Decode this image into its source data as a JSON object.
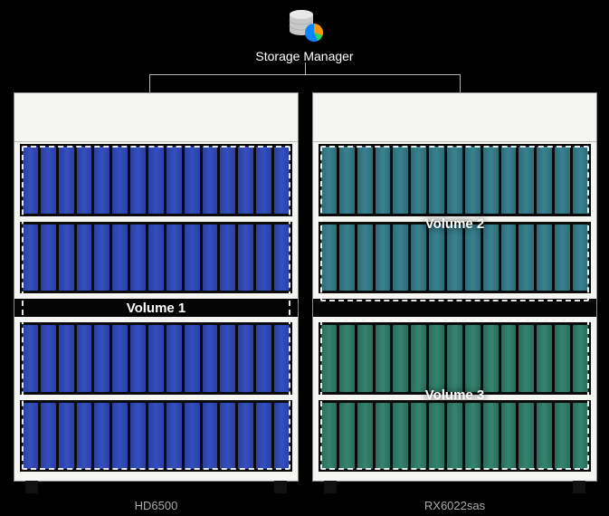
{
  "header": {
    "title": "Storage Manager"
  },
  "units": {
    "left": {
      "model": "HD6500",
      "volumes": [
        {
          "label": "Volume 1",
          "color": "blue"
        }
      ]
    },
    "right": {
      "model": "RX6022sas",
      "volumes": [
        {
          "label": "Volume 2",
          "color": "teal"
        },
        {
          "label": "Volume 3",
          "color": "green"
        }
      ]
    }
  }
}
